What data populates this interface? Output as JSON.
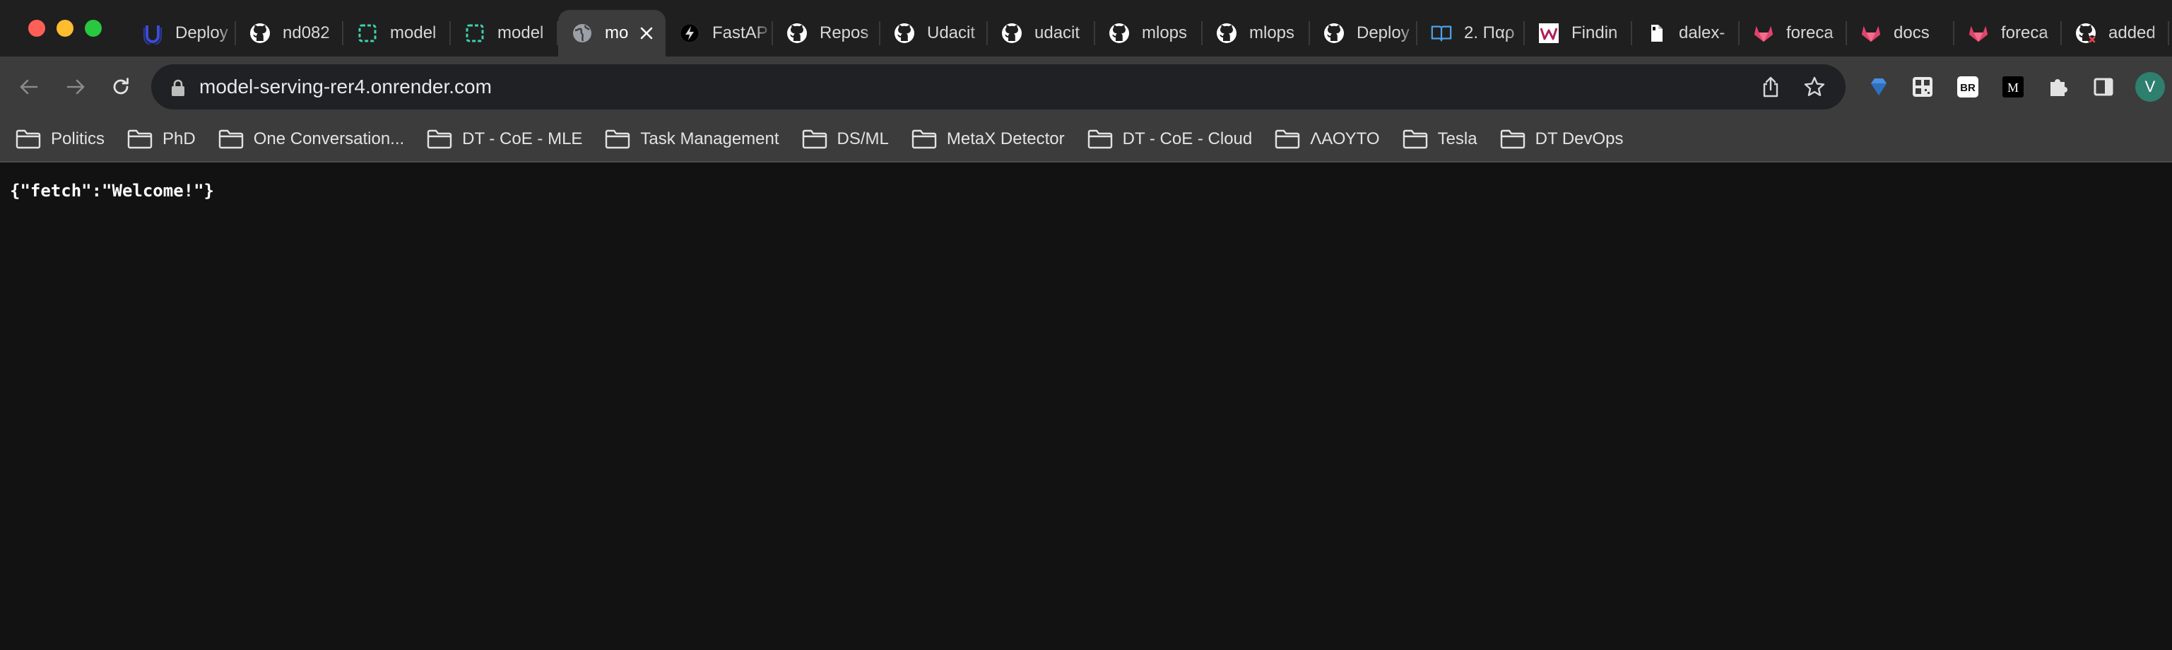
{
  "browser": {
    "tabs": [
      {
        "title": "Deploy",
        "icon": "udacity-icon"
      },
      {
        "title": "nd082",
        "icon": "github-icon"
      },
      {
        "title": "model",
        "icon": "render-icon"
      },
      {
        "title": "model",
        "icon": "render-icon"
      },
      {
        "title": "mo",
        "icon": "globe-icon",
        "active": true
      },
      {
        "title": "FastAP",
        "icon": "fastapi-icon"
      },
      {
        "title": "Repos",
        "icon": "github-icon"
      },
      {
        "title": "Udacit",
        "icon": "github-icon"
      },
      {
        "title": "udacit",
        "icon": "github-icon"
      },
      {
        "title": "mlops",
        "icon": "github-icon"
      },
      {
        "title": "mlops",
        "icon": "github-icon"
      },
      {
        "title": "Deploy",
        "icon": "github-icon"
      },
      {
        "title": "2. Παρ",
        "icon": "book-icon"
      },
      {
        "title": "Findin",
        "icon": "wiki-icon"
      },
      {
        "title": "dalex-",
        "icon": "file-icon"
      },
      {
        "title": "foreca",
        "icon": "gitlab-icon"
      },
      {
        "title": "docs",
        "icon": "gitlab-icon"
      },
      {
        "title": "foreca",
        "icon": "gitlab-icon"
      },
      {
        "title": "added",
        "icon": "github-error-icon"
      }
    ],
    "url": "model-serving-rer4.onrender.com",
    "profile_initial": "V",
    "extensions": [
      {
        "name": "gem-extension-icon"
      },
      {
        "name": "qr-extension-icon"
      },
      {
        "name": "br-extension-icon",
        "label": "BR"
      },
      {
        "name": "m-extension-icon",
        "label": "M"
      },
      {
        "name": "puzzle-extensions-icon"
      },
      {
        "name": "side-panel-icon"
      }
    ]
  },
  "bookmarks": [
    "Politics",
    "PhD",
    "One Conversation...",
    "DT - CoE - MLE",
    "Task Management",
    "DS/ML",
    "MetaX Detector",
    "DT - CoE - Cloud",
    "ΛΑΟΥΤΟ",
    "Tesla",
    "DT DevOps"
  ],
  "page": {
    "body_text": "{\"fetch\":\"Welcome!\"}"
  },
  "colors": {
    "tab_strip": "#1f1f1f",
    "toolbar": "#3c3c3c",
    "omnibox": "#202124",
    "page_background": "#121212",
    "avatar": "#2f7f6f"
  }
}
